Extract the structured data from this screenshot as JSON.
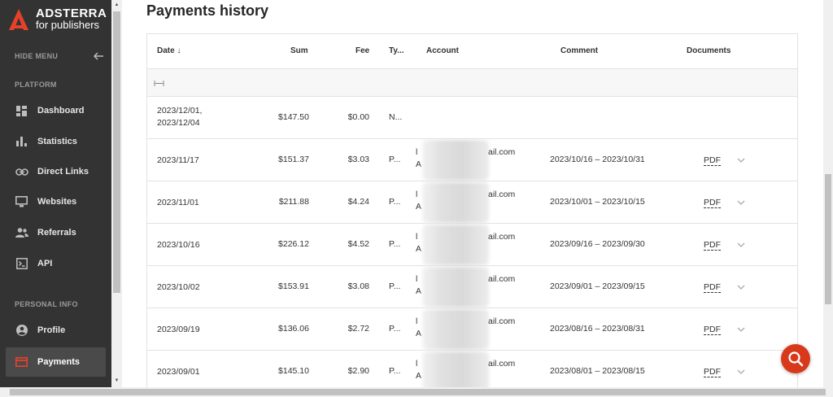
{
  "brand": {
    "title": "ADSTERRA",
    "subtitle": "for publishers",
    "accent": "#e8412a"
  },
  "sidebar": {
    "hide_menu": "HIDE MENU",
    "platform_label": "PLATFORM",
    "platform_items": [
      {
        "label": "Dashboard",
        "icon": "dashboard-icon"
      },
      {
        "label": "Statistics",
        "icon": "bar-chart-icon"
      },
      {
        "label": "Direct Links",
        "icon": "link-icon"
      },
      {
        "label": "Websites",
        "icon": "monitor-icon"
      },
      {
        "label": "Referrals",
        "icon": "users-icon"
      },
      {
        "label": "API",
        "icon": "terminal-icon"
      }
    ],
    "personal_label": "PERSONAL INFO",
    "personal_items": [
      {
        "label": "Profile",
        "icon": "profile-icon"
      },
      {
        "label": "Payments",
        "icon": "card-icon",
        "active": true
      }
    ]
  },
  "main": {
    "title": "Payments history",
    "columns": {
      "date": "Date ↓",
      "sum": "Sum",
      "fee": "Fee",
      "type": "Ty...",
      "account": "Account",
      "comment": "Comment",
      "documents": "Documents"
    },
    "rows": [
      {
        "date1": "2023/12/01,",
        "date2": "2023/12/04",
        "sum": "$147.50",
        "fee": "$0.00",
        "type": "N...",
        "account_pre": "",
        "account_suffix": "",
        "comment": "",
        "doc": ""
      },
      {
        "date1": "2023/11/17",
        "sum": "$151.37",
        "fee": "$3.03",
        "type": "P...",
        "account_pre1": "l",
        "account_pre2": "A",
        "account_suffix": "ail.com",
        "comment": "2023/10/16 – 2023/10/31",
        "doc": "PDF"
      },
      {
        "date1": "2023/11/01",
        "sum": "$211.88",
        "fee": "$4.24",
        "type": "P...",
        "account_pre1": "l",
        "account_pre2": "A",
        "account_suffix": "ail.com",
        "comment": "2023/10/01 – 2023/10/15",
        "doc": "PDF"
      },
      {
        "date1": "2023/10/16",
        "sum": "$226.12",
        "fee": "$4.52",
        "type": "P...",
        "account_pre1": "l",
        "account_pre2": "A",
        "account_suffix": "ail.com",
        "comment": "2023/09/16 – 2023/09/30",
        "doc": "PDF"
      },
      {
        "date1": "2023/10/02",
        "sum": "$153.91",
        "fee": "$3.08",
        "type": "P...",
        "account_pre1": "l",
        "account_pre2": "A",
        "account_suffix": "ail.com",
        "comment": "2023/09/01 – 2023/09/15",
        "doc": "PDF"
      },
      {
        "date1": "2023/09/19",
        "sum": "$136.06",
        "fee": "$2.72",
        "type": "P...",
        "account_pre1": "l",
        "account_pre2": "A",
        "account_suffix": "ail.com",
        "comment": "2023/08/16 – 2023/08/31",
        "doc": "PDF"
      },
      {
        "date1": "2023/09/01",
        "sum": "$145.10",
        "fee": "$2.90",
        "type": "P...",
        "account_pre1": "l",
        "account_pre2": "A",
        "account_suffix": "ail.com",
        "comment": "2023/08/01 – 2023/08/15",
        "doc": "PDF"
      }
    ]
  },
  "chat_icon": "search-chat-icon"
}
